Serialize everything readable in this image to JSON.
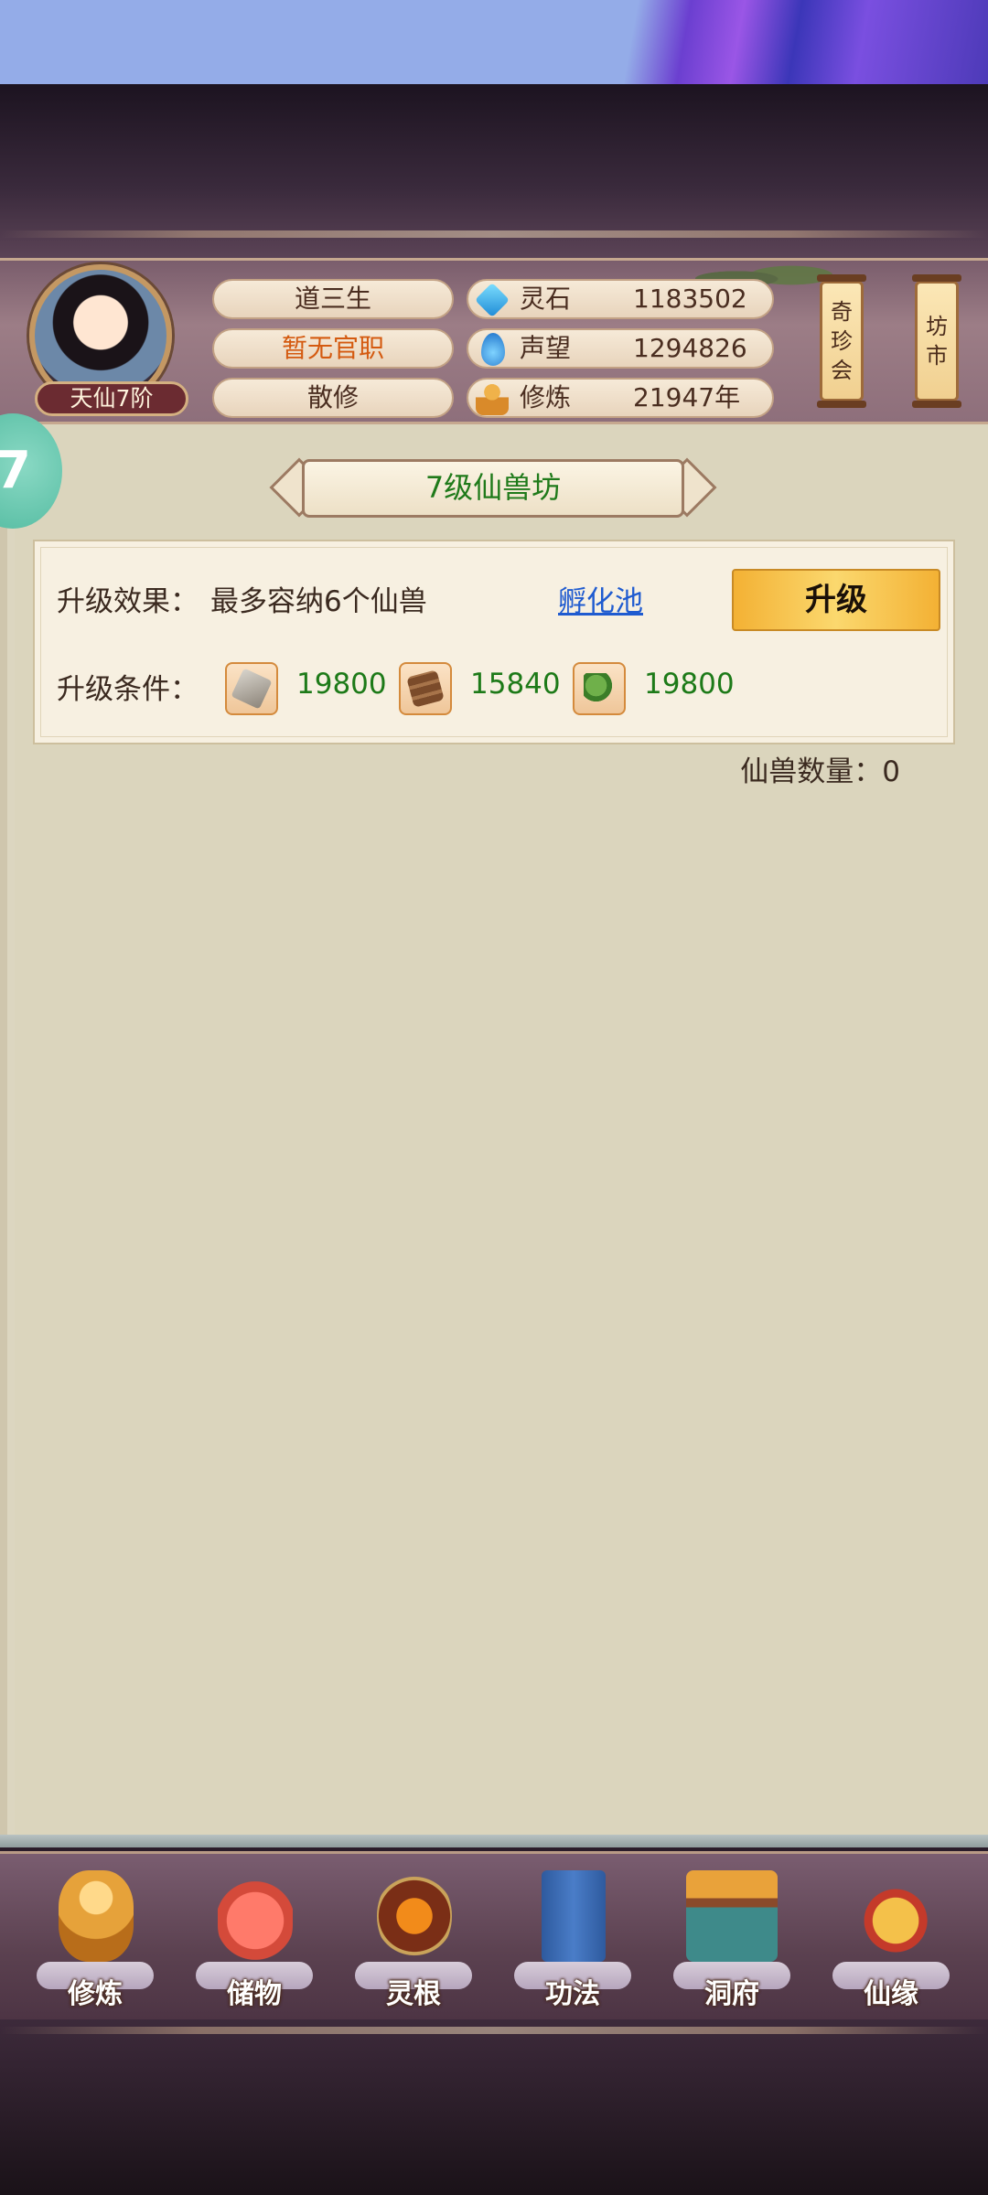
{
  "header": {
    "rank_badge": "天仙7阶",
    "player_name": "道三生",
    "office": "暂无官职",
    "sect": "散修",
    "stats": [
      {
        "label": "灵石",
        "value": "1183502",
        "icon": "spirit-stone-icon"
      },
      {
        "label": "声望",
        "value": "1294826",
        "icon": "prestige-icon"
      },
      {
        "label": "修炼",
        "value": "21947年",
        "icon": "cultivation-icon"
      }
    ],
    "side_buttons": [
      {
        "label_lines": [
          "奇",
          "珍",
          "会"
        ]
      },
      {
        "label_lines": [
          "坊",
          "市"
        ]
      }
    ]
  },
  "float_badge": "7",
  "panel": {
    "title": "7级仙兽坊",
    "effect_label": "升级效果：",
    "effect_text": "最多容纳6个仙兽",
    "hatch_link": "孵化池",
    "upgrade_button": "升级",
    "condition_label": "升级条件：",
    "resources": [
      {
        "icon": "ore-icon",
        "value": "19800"
      },
      {
        "icon": "wood-icon",
        "value": "15840"
      },
      {
        "icon": "herb-icon",
        "value": "19800"
      }
    ],
    "beast_count_label": "仙兽数量：",
    "beast_count": "0"
  },
  "nav": [
    {
      "label": "修炼",
      "icon": "cultivate-icon"
    },
    {
      "label": "储物",
      "icon": "storage-bag-icon"
    },
    {
      "label": "灵根",
      "icon": "spirit-root-icon"
    },
    {
      "label": "功法",
      "icon": "technique-book-icon"
    },
    {
      "label": "洞府",
      "icon": "cave-abode-icon"
    },
    {
      "label": "仙缘",
      "icon": "fate-gourd-icon"
    }
  ],
  "colors": {
    "title_green": "#1f7a1a",
    "office_orange": "#d45a10",
    "link_blue": "#1f5bd0",
    "upgrade_gold": "#f3b134"
  }
}
